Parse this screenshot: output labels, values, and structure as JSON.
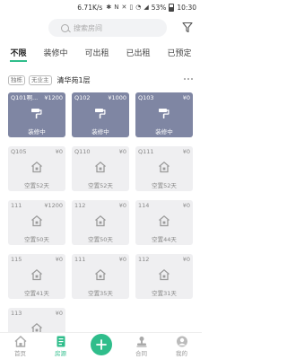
{
  "status_bar": {
    "speed": "6.71K/s",
    "battery": "53%",
    "time": "10:30"
  },
  "search": {
    "placeholder": "搜索房间"
  },
  "tabs": [
    {
      "label": "不限",
      "active": true
    },
    {
      "label": "装修中",
      "active": false
    },
    {
      "label": "可出租",
      "active": false
    },
    {
      "label": "已出租",
      "active": false
    },
    {
      "label": "已预定",
      "active": false
    }
  ],
  "building": {
    "tags": [
      "独栋",
      "无业主"
    ],
    "name": "清华苑1层"
  },
  "rooms": [
    {
      "id": "Q101啊...",
      "price": "¥1200",
      "status": "装修中",
      "state": "renovating"
    },
    {
      "id": "Q102",
      "price": "¥1000",
      "status": "装修中",
      "state": "renovating"
    },
    {
      "id": "Q103",
      "price": "¥0",
      "status": "装修中",
      "state": "renovating"
    },
    {
      "id": "Q105",
      "price": "¥0",
      "status": "空置52天",
      "state": "vacant"
    },
    {
      "id": "Q110",
      "price": "¥0",
      "status": "空置52天",
      "state": "vacant"
    },
    {
      "id": "Q111",
      "price": "¥0",
      "status": "空置52天",
      "state": "vacant"
    },
    {
      "id": "111",
      "price": "¥1200",
      "status": "空置50天",
      "state": "vacant"
    },
    {
      "id": "112",
      "price": "¥0",
      "status": "空置50天",
      "state": "vacant"
    },
    {
      "id": "114",
      "price": "¥0",
      "status": "空置44天",
      "state": "vacant"
    },
    {
      "id": "115",
      "price": "¥0",
      "status": "空置41天",
      "state": "vacant"
    },
    {
      "id": "111",
      "price": "¥0",
      "status": "空置35天",
      "state": "vacant"
    },
    {
      "id": "112",
      "price": "¥0",
      "status": "空置31天",
      "state": "vacant"
    },
    {
      "id": "113",
      "price": "¥0",
      "status": "",
      "state": "vacant"
    }
  ],
  "nav": {
    "home": "首页",
    "rooms": "房源",
    "contract": "合同",
    "mine": "我的"
  },
  "colors": {
    "accent": "#2fbd8b",
    "renovating": "#7f86a3",
    "vacant": "#efeff1"
  }
}
